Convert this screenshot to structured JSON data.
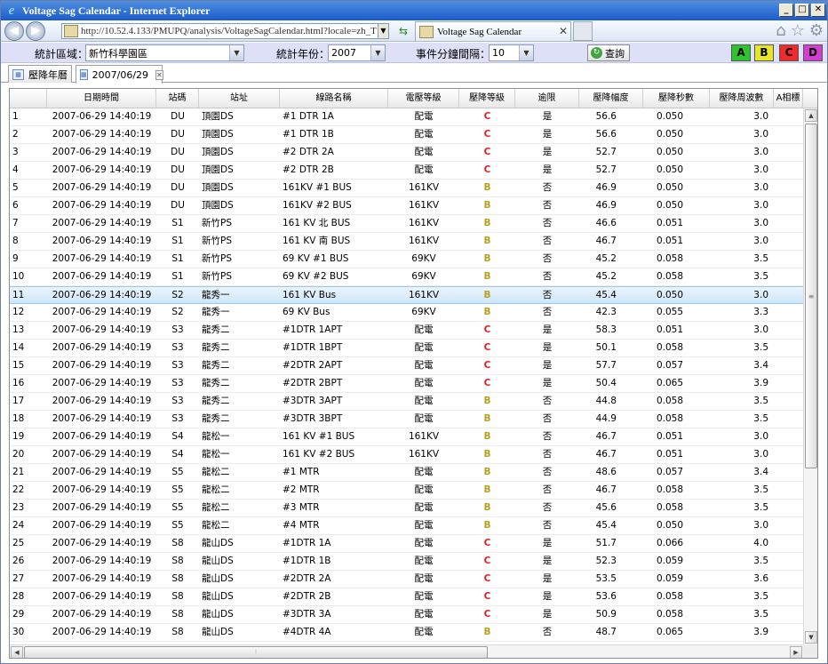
{
  "window": {
    "title": "Voltage Sag Calendar - Internet Explorer",
    "ie_glyph": "e",
    "min": "_",
    "max": "□",
    "close": "✕"
  },
  "browser": {
    "address": "http://10.52.4.133/PMUPQ/analysis/VoltageSagCalendar.html?locale=zh_T",
    "tab_title": "Voltage Sag Calendar",
    "tab_close": "✕",
    "back_glyph": "◀",
    "fwd_glyph": "▶"
  },
  "filter": {
    "region_label": "統計區域：",
    "region_value": "新竹科學園區",
    "year_label": "統計年份：",
    "year_value": "2007",
    "interval_label": "事件分鐘間隔：",
    "interval_value": "10",
    "query_label": "查詢",
    "levels": [
      {
        "label": "A",
        "color": "#2CC52C"
      },
      {
        "label": "B",
        "color": "#E5E52A"
      },
      {
        "label": "C",
        "color": "#F02A2A"
      },
      {
        "label": "D",
        "color": "#D23ED2"
      }
    ]
  },
  "tabs": [
    {
      "label": "壓降年曆"
    },
    {
      "label": "2007/06/29"
    }
  ],
  "columns": [
    "",
    "日期時間",
    "站碼",
    "站址",
    "線路名稱",
    "電壓等級",
    "壓降等級",
    "逾限",
    "壓降幅度",
    "壓降秒數",
    "壓降周波數",
    "A相標"
  ],
  "grade_colors": {
    "C": "#E02020",
    "B": "#B8A020"
  },
  "rows": [
    [
      "1",
      "2007-06-29 14:40:19",
      "DU",
      "頂園DS",
      "#1 DTR 1A",
      "配電",
      "C",
      "是",
      "56.6",
      "0.050",
      "3.0"
    ],
    [
      "2",
      "2007-06-29 14:40:19",
      "DU",
      "頂園DS",
      "#1 DTR 1B",
      "配電",
      "C",
      "是",
      "56.6",
      "0.050",
      "3.0"
    ],
    [
      "3",
      "2007-06-29 14:40:19",
      "DU",
      "頂園DS",
      "#2 DTR 2A",
      "配電",
      "C",
      "是",
      "52.7",
      "0.050",
      "3.0"
    ],
    [
      "4",
      "2007-06-29 14:40:19",
      "DU",
      "頂園DS",
      "#2 DTR 2B",
      "配電",
      "C",
      "是",
      "52.7",
      "0.050",
      "3.0"
    ],
    [
      "5",
      "2007-06-29 14:40:19",
      "DU",
      "頂園DS",
      "161KV #1 BUS",
      "161KV",
      "B",
      "否",
      "46.9",
      "0.050",
      "3.0"
    ],
    [
      "6",
      "2007-06-29 14:40:19",
      "DU",
      "頂園DS",
      "161KV #2 BUS",
      "161KV",
      "B",
      "否",
      "46.9",
      "0.050",
      "3.0"
    ],
    [
      "7",
      "2007-06-29 14:40:19",
      "S1",
      "新竹PS",
      "161 KV 北 BUS",
      "161KV",
      "B",
      "否",
      "46.6",
      "0.051",
      "3.0"
    ],
    [
      "8",
      "2007-06-29 14:40:19",
      "S1",
      "新竹PS",
      "161 KV 南 BUS",
      "161KV",
      "B",
      "否",
      "46.7",
      "0.051",
      "3.0"
    ],
    [
      "9",
      "2007-06-29 14:40:19",
      "S1",
      "新竹PS",
      "69 KV #1 BUS",
      "69KV",
      "B",
      "否",
      "45.2",
      "0.058",
      "3.5"
    ],
    [
      "10",
      "2007-06-29 14:40:19",
      "S1",
      "新竹PS",
      "69 KV #2 BUS",
      "69KV",
      "B",
      "否",
      "45.2",
      "0.058",
      "3.5"
    ],
    [
      "11",
      "2007-06-29 14:40:19",
      "S2",
      "龍秀一",
      "161 KV Bus",
      "161KV",
      "B",
      "否",
      "45.4",
      "0.050",
      "3.0"
    ],
    [
      "12",
      "2007-06-29 14:40:19",
      "S2",
      "龍秀一",
      "69 KV Bus",
      "69KV",
      "B",
      "否",
      "42.3",
      "0.055",
      "3.3"
    ],
    [
      "13",
      "2007-06-29 14:40:19",
      "S3",
      "龍秀二",
      "#1DTR 1APT",
      "配電",
      "C",
      "是",
      "58.3",
      "0.051",
      "3.0"
    ],
    [
      "14",
      "2007-06-29 14:40:19",
      "S3",
      "龍秀二",
      "#1DTR 1BPT",
      "配電",
      "C",
      "是",
      "50.1",
      "0.058",
      "3.5"
    ],
    [
      "15",
      "2007-06-29 14:40:19",
      "S3",
      "龍秀二",
      "#2DTR 2APT",
      "配電",
      "C",
      "是",
      "57.7",
      "0.057",
      "3.4"
    ],
    [
      "16",
      "2007-06-29 14:40:19",
      "S3",
      "龍秀二",
      "#2DTR 2BPT",
      "配電",
      "C",
      "是",
      "50.4",
      "0.065",
      "3.9"
    ],
    [
      "17",
      "2007-06-29 14:40:19",
      "S3",
      "龍秀二",
      "#3DTR 3APT",
      "配電",
      "B",
      "否",
      "44.8",
      "0.058",
      "3.5"
    ],
    [
      "18",
      "2007-06-29 14:40:19",
      "S3",
      "龍秀二",
      "#3DTR 3BPT",
      "配電",
      "B",
      "否",
      "44.9",
      "0.058",
      "3.5"
    ],
    [
      "19",
      "2007-06-29 14:40:19",
      "S4",
      "龍松一",
      "161 KV #1 BUS",
      "161KV",
      "B",
      "否",
      "46.7",
      "0.051",
      "3.0"
    ],
    [
      "20",
      "2007-06-29 14:40:19",
      "S4",
      "龍松一",
      "161 KV #2 BUS",
      "161KV",
      "B",
      "否",
      "46.7",
      "0.051",
      "3.0"
    ],
    [
      "21",
      "2007-06-29 14:40:19",
      "S5",
      "龍松二",
      "#1 MTR",
      "配電",
      "B",
      "否",
      "48.6",
      "0.057",
      "3.4"
    ],
    [
      "22",
      "2007-06-29 14:40:19",
      "S5",
      "龍松二",
      "#2 MTR",
      "配電",
      "B",
      "否",
      "46.7",
      "0.058",
      "3.5"
    ],
    [
      "23",
      "2007-06-29 14:40:19",
      "S5",
      "龍松二",
      "#3 MTR",
      "配電",
      "B",
      "否",
      "45.6",
      "0.058",
      "3.5"
    ],
    [
      "24",
      "2007-06-29 14:40:19",
      "S5",
      "龍松二",
      "#4 MTR",
      "配電",
      "B",
      "否",
      "45.4",
      "0.050",
      "3.0"
    ],
    [
      "25",
      "2007-06-29 14:40:19",
      "S8",
      "龍山DS",
      "#1DTR 1A",
      "配電",
      "C",
      "是",
      "51.7",
      "0.066",
      "4.0"
    ],
    [
      "26",
      "2007-06-29 14:40:19",
      "S8",
      "龍山DS",
      "#1DTR 1B",
      "配電",
      "C",
      "是",
      "52.3",
      "0.059",
      "3.5"
    ],
    [
      "27",
      "2007-06-29 14:40:19",
      "S8",
      "龍山DS",
      "#2DTR 2A",
      "配電",
      "C",
      "是",
      "53.5",
      "0.059",
      "3.6"
    ],
    [
      "28",
      "2007-06-29 14:40:19",
      "S8",
      "龍山DS",
      "#2DTR 2B",
      "配電",
      "C",
      "是",
      "53.6",
      "0.058",
      "3.5"
    ],
    [
      "29",
      "2007-06-29 14:40:19",
      "S8",
      "龍山DS",
      "#3DTR 3A",
      "配電",
      "C",
      "是",
      "50.9",
      "0.058",
      "3.5"
    ],
    [
      "30",
      "2007-06-29 14:40:19",
      "S8",
      "龍山DS",
      "#4DTR 4A",
      "配電",
      "B",
      "否",
      "48.7",
      "0.065",
      "3.9"
    ]
  ],
  "selected_row": 11
}
